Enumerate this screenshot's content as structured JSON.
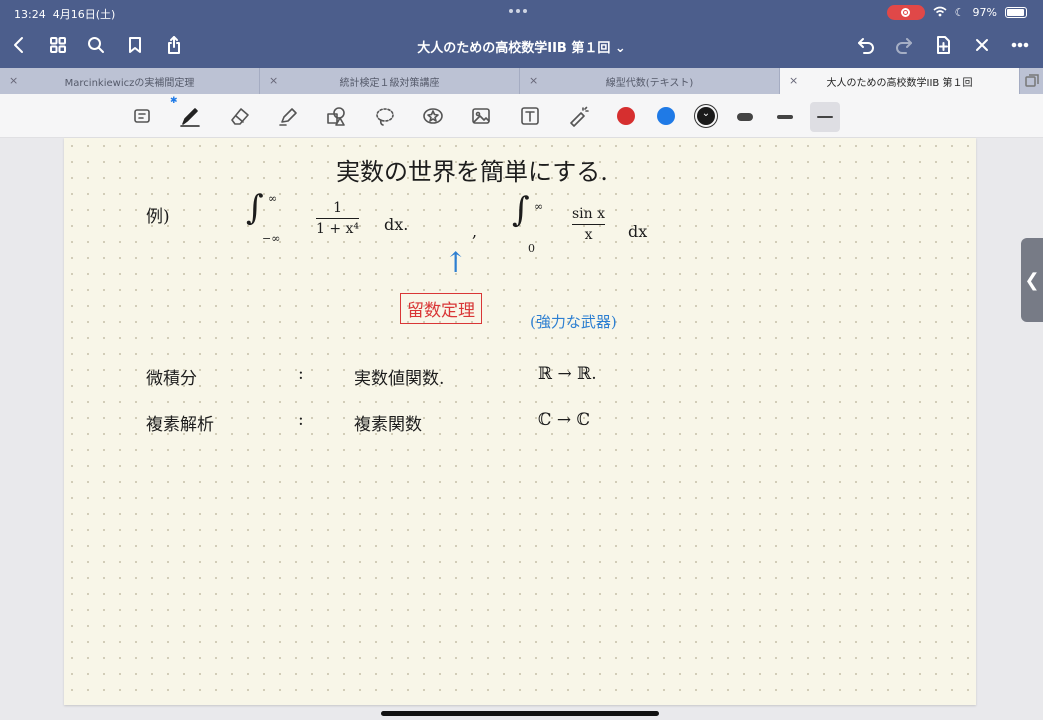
{
  "status": {
    "time": "13:24",
    "date": "4月16日(土)",
    "battery_text": "97%",
    "battery_level": 0.97
  },
  "nav": {
    "doc_title": "大人のための高校数学IIB 第１回 ⌄"
  },
  "tabs": [
    {
      "label": "Marcinkiewiczの実補間定理",
      "active": false
    },
    {
      "label": "統計検定１級対策講座",
      "active": false
    },
    {
      "label": "線型代数(テキスト)",
      "active": false
    },
    {
      "label": "大人のための高校数学IIB 第１回",
      "active": true
    }
  ],
  "toolbar": {
    "colors": [
      "#d62f2f",
      "#1f7ae6",
      "#1a1a1a"
    ],
    "selected_color": "#1a1a1a",
    "bluetooth_glyph": "✱"
  },
  "note": {
    "heading": "実数の世界を簡単にする.",
    "example_label": "例)",
    "int1": {
      "upper": "∞",
      "lower": "−∞",
      "numerator": "1",
      "denominator": "1 + x⁴",
      "dx": "dx."
    },
    "comma": ",",
    "int2": {
      "upper": "∞",
      "lower": "0",
      "numerator": "sin x",
      "denominator": "x",
      "dx": "dx"
    },
    "arrow": "↑",
    "theorem_boxed": "留数定理",
    "theorem_note": "(強力な武器)",
    "row1": {
      "subject": "微積分",
      "colon": ":",
      "kind": "実数値関数.",
      "mapping": "ℝ → ℝ."
    },
    "row2": {
      "subject": "複素解析",
      "colon": ":",
      "kind": "複素関数",
      "mapping": "ℂ → ℂ"
    }
  },
  "side_handle": "❮"
}
